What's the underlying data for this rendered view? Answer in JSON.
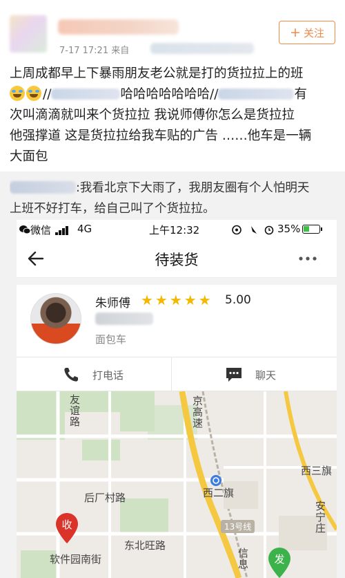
{
  "post": {
    "meta": "7-17 17:21  来自",
    "follow_label": "关注",
    "lines": [
      "上周成都早上下暴雨朋友老公就是打的货拉拉上的班",
      "哈哈哈哈哈哈哈//",
      "有",
      "次叫滴滴就叫来个货拉拉  我说师傅你怎么是货拉拉",
      "他强撑道 这是货拉拉给我车贴的广告 ……他车是一辆",
      "大面包"
    ]
  },
  "comment": {
    "line1": ":我看北京下大雨了，我朋友圈有个人怕明天",
    "line2": "上班不好打车，给自己叫了个货拉拉。"
  },
  "phone": {
    "status": {
      "carrier": "微信",
      "network": "4G",
      "time": "上午12:32",
      "battery": "35%"
    },
    "nav_title": "待装货",
    "driver": {
      "name": "朱师傅",
      "stars": "★★★★★",
      "rating": "5.00",
      "vehicle_type": "面包车"
    },
    "actions": {
      "call": "打电话",
      "chat": "聊天"
    },
    "map": {
      "labels": {
        "youyi_road": "友谊路",
        "jinggao_expressway": "京高速",
        "xisanqi": "西三旗",
        "xierqi": "西二旗",
        "houchangcun_road": "后厂村路",
        "dongbeiwang_road": "东北旺路",
        "ruanjianyuan_south": "软件园南街",
        "anning_zhuang": "安宁庄",
        "xinxi": "信息",
        "line13": "13号线",
        "receive_pin": "收",
        "dispatch_pin": "发"
      }
    }
  }
}
